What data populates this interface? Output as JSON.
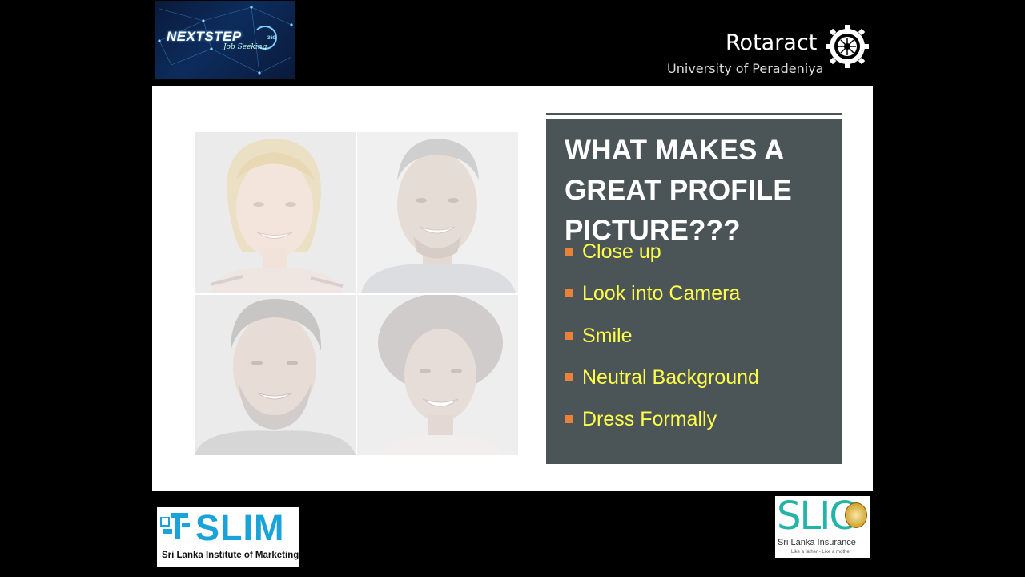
{
  "header": {
    "nextstep": {
      "title": "NEXTSTEP",
      "subtitle": "Job Seeking",
      "badge": "360"
    },
    "rotaract": {
      "name": "Rotaract",
      "subtitle": "University of Peradeniya"
    }
  },
  "slide": {
    "title": "WHAT MAKES A GREAT PROFILE PICTURE???",
    "bullets": [
      "Close up",
      "Look into Camera",
      "Smile",
      "Neutral Background",
      "Dress Formally"
    ],
    "photos": [
      "woman-blonde",
      "man-short-hair",
      "man-beard",
      "woman-curly-hair"
    ]
  },
  "footer": {
    "slim": {
      "name": "SLIM",
      "subtitle": "Sri Lanka Institute of Marketing"
    },
    "slic": {
      "name": "SLIC",
      "subtitle": "Sri Lanka Insurance",
      "tagline": "Like a father - Like a mother"
    }
  },
  "colors": {
    "panel": "#4b5457",
    "bullet_text": "#ffff4a",
    "bullet_marker": "#e8823b",
    "slim_blue": "#1aa3d9",
    "slic_teal": "#23b3a8"
  }
}
